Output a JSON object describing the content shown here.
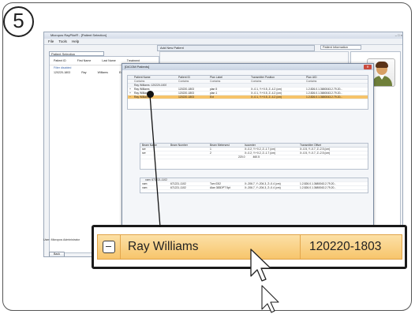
{
  "step": {
    "number": "5"
  },
  "window": {
    "title": "Micropos RayPilot® - [Patient Selection]",
    "menu": [
      "File",
      "Tools",
      "Help"
    ],
    "controls": "– □ ×"
  },
  "patient_selection": {
    "tab": "Patient Selection",
    "columns": [
      "Patient ID",
      "First Name",
      "Last Name",
      "Treatment"
    ],
    "filter_hint": "Filter disabled",
    "rows": [
      [
        "120220-1803",
        "Ray",
        "Williams",
        "Ext"
      ]
    ]
  },
  "add_new_patient": {
    "label": "Add New Patient"
  },
  "patient_information": {
    "label": "Patient Information"
  },
  "dialog": {
    "title": "[DICOM Patients]",
    "grid": {
      "columns": [
        "",
        "Patient Name",
        "Patient ID",
        "Plan Label",
        "Transmitter Position",
        "Plan UID"
      ],
      "filter": [
        "",
        "Contains",
        "Contains",
        "Contains",
        "Contains",
        "Contains"
      ],
      "group_row": "Ray Williams: 120220-1803",
      "rows": [
        [
          "+",
          "Ray Williams",
          "120220-1803",
          "plan 5",
          "X:-0.1, Y:+0.5, Z:-4.2 (cm)",
          "1.2.826.0.1.3680043.2.79.20..."
        ],
        [
          "+",
          "Ray Williams",
          "120220-1803",
          "plan 1",
          "X:-0.1, Y:+0.5, Z:-4.2 (cm)",
          "1.2.826.0.1.3680043.2.79.20..."
        ],
        [
          "−",
          "Ray Williams",
          "120220-1803",
          "Ext",
          "X:-0.1, Y:+0.5, Z:-4.2 (cm)",
          "1.2.826.0.1.3680043.2.79.20..."
        ]
      ]
    },
    "beams": {
      "columns": [
        "Beam Name",
        "Beam Number",
        "Beam Metersest",
        "Isocenter",
        "Transmitter Offset"
      ],
      "rows": [
        [
          "ser",
          "",
          "1",
          "220.0",
          "X:-0.2, Y:+0.2, Z:-1.7 (cm)",
          "X:-0.5, Y:-0.7, Z:-2.5 (cm)"
        ],
        [
          "ser",
          "",
          "2",
          "460.5",
          "X:-0.2, Y:+0.2, Z:-1.7 (cm)",
          "X:-0.5, Y:-0.7, Z:-2.5 (cm)"
        ]
      ]
    },
    "other": {
      "group_row": "xam: 671221-1102",
      "rows": [
        [
          "xam",
          "671221-1102",
          "Tom 03/2",
          "X:-206.7, Y:-204.3, Z:-0.4 (cm)",
          "1.2.826.0.1.3680043.2.79.20..."
        ],
        [
          "xam",
          "671221-1102",
          "Alan 383DPT 5pt",
          "X:-206.7, Y:-204.3, Z:-0.4 (cm)",
          "1.2.826.0.1.3680043.2.79.20..."
        ]
      ]
    },
    "tps_label": "TPS Coordinates",
    "tps_value": "Unit_BI",
    "buttons": {
      "browse": "Browse",
      "import1": "Import",
      "clear": "Clear",
      "save": "Save",
      "import2": "Import"
    }
  },
  "back_button": "Back",
  "user_line": "User: Micropos Administrator",
  "magnifier": {
    "patient_name": "Ray Williams",
    "patient_id": "120220-1803",
    "row_state": "collapse"
  },
  "colors": {
    "selected_row": "#f7c56c",
    "magnifier_border": "#1a1a1a"
  }
}
